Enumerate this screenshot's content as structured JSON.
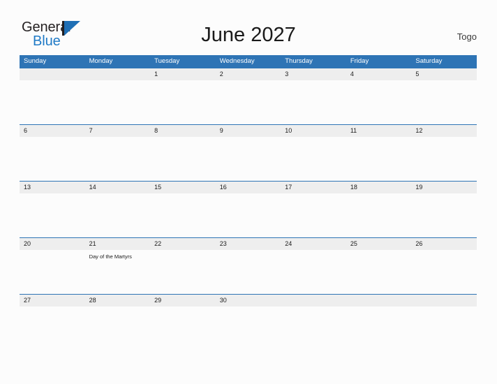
{
  "brand": {
    "name_part1": "General",
    "name_part2": "Blue",
    "mark": "triangle-logo-mark"
  },
  "header": {
    "title": "June 2027",
    "country": "Togo"
  },
  "calendar": {
    "weekday_headers": [
      "Sunday",
      "Monday",
      "Tuesday",
      "Wednesday",
      "Thursday",
      "Friday",
      "Saturday"
    ],
    "weeks": [
      {
        "days": [
          {
            "date": "",
            "events": []
          },
          {
            "date": "",
            "events": []
          },
          {
            "date": "1",
            "events": []
          },
          {
            "date": "2",
            "events": []
          },
          {
            "date": "3",
            "events": []
          },
          {
            "date": "4",
            "events": []
          },
          {
            "date": "5",
            "events": []
          }
        ]
      },
      {
        "days": [
          {
            "date": "6",
            "events": []
          },
          {
            "date": "7",
            "events": []
          },
          {
            "date": "8",
            "events": []
          },
          {
            "date": "9",
            "events": []
          },
          {
            "date": "10",
            "events": []
          },
          {
            "date": "11",
            "events": []
          },
          {
            "date": "12",
            "events": []
          }
        ]
      },
      {
        "days": [
          {
            "date": "13",
            "events": []
          },
          {
            "date": "14",
            "events": []
          },
          {
            "date": "15",
            "events": []
          },
          {
            "date": "16",
            "events": []
          },
          {
            "date": "17",
            "events": []
          },
          {
            "date": "18",
            "events": []
          },
          {
            "date": "19",
            "events": []
          }
        ]
      },
      {
        "days": [
          {
            "date": "20",
            "events": []
          },
          {
            "date": "21",
            "events": [
              "Day of the Martyrs"
            ]
          },
          {
            "date": "22",
            "events": []
          },
          {
            "date": "23",
            "events": []
          },
          {
            "date": "24",
            "events": []
          },
          {
            "date": "25",
            "events": []
          },
          {
            "date": "26",
            "events": []
          }
        ]
      },
      {
        "days": [
          {
            "date": "27",
            "events": []
          },
          {
            "date": "28",
            "events": []
          },
          {
            "date": "29",
            "events": []
          },
          {
            "date": "30",
            "events": []
          },
          {
            "date": "",
            "events": []
          },
          {
            "date": "",
            "events": []
          },
          {
            "date": "",
            "events": []
          }
        ]
      }
    ]
  },
  "colors": {
    "header_blue": "#2e74b5",
    "brand_blue": "#1f7ac6",
    "date_band": "#eeeeee",
    "page_background": "#fcfcfc",
    "text_dark": "#1a1a1a"
  }
}
